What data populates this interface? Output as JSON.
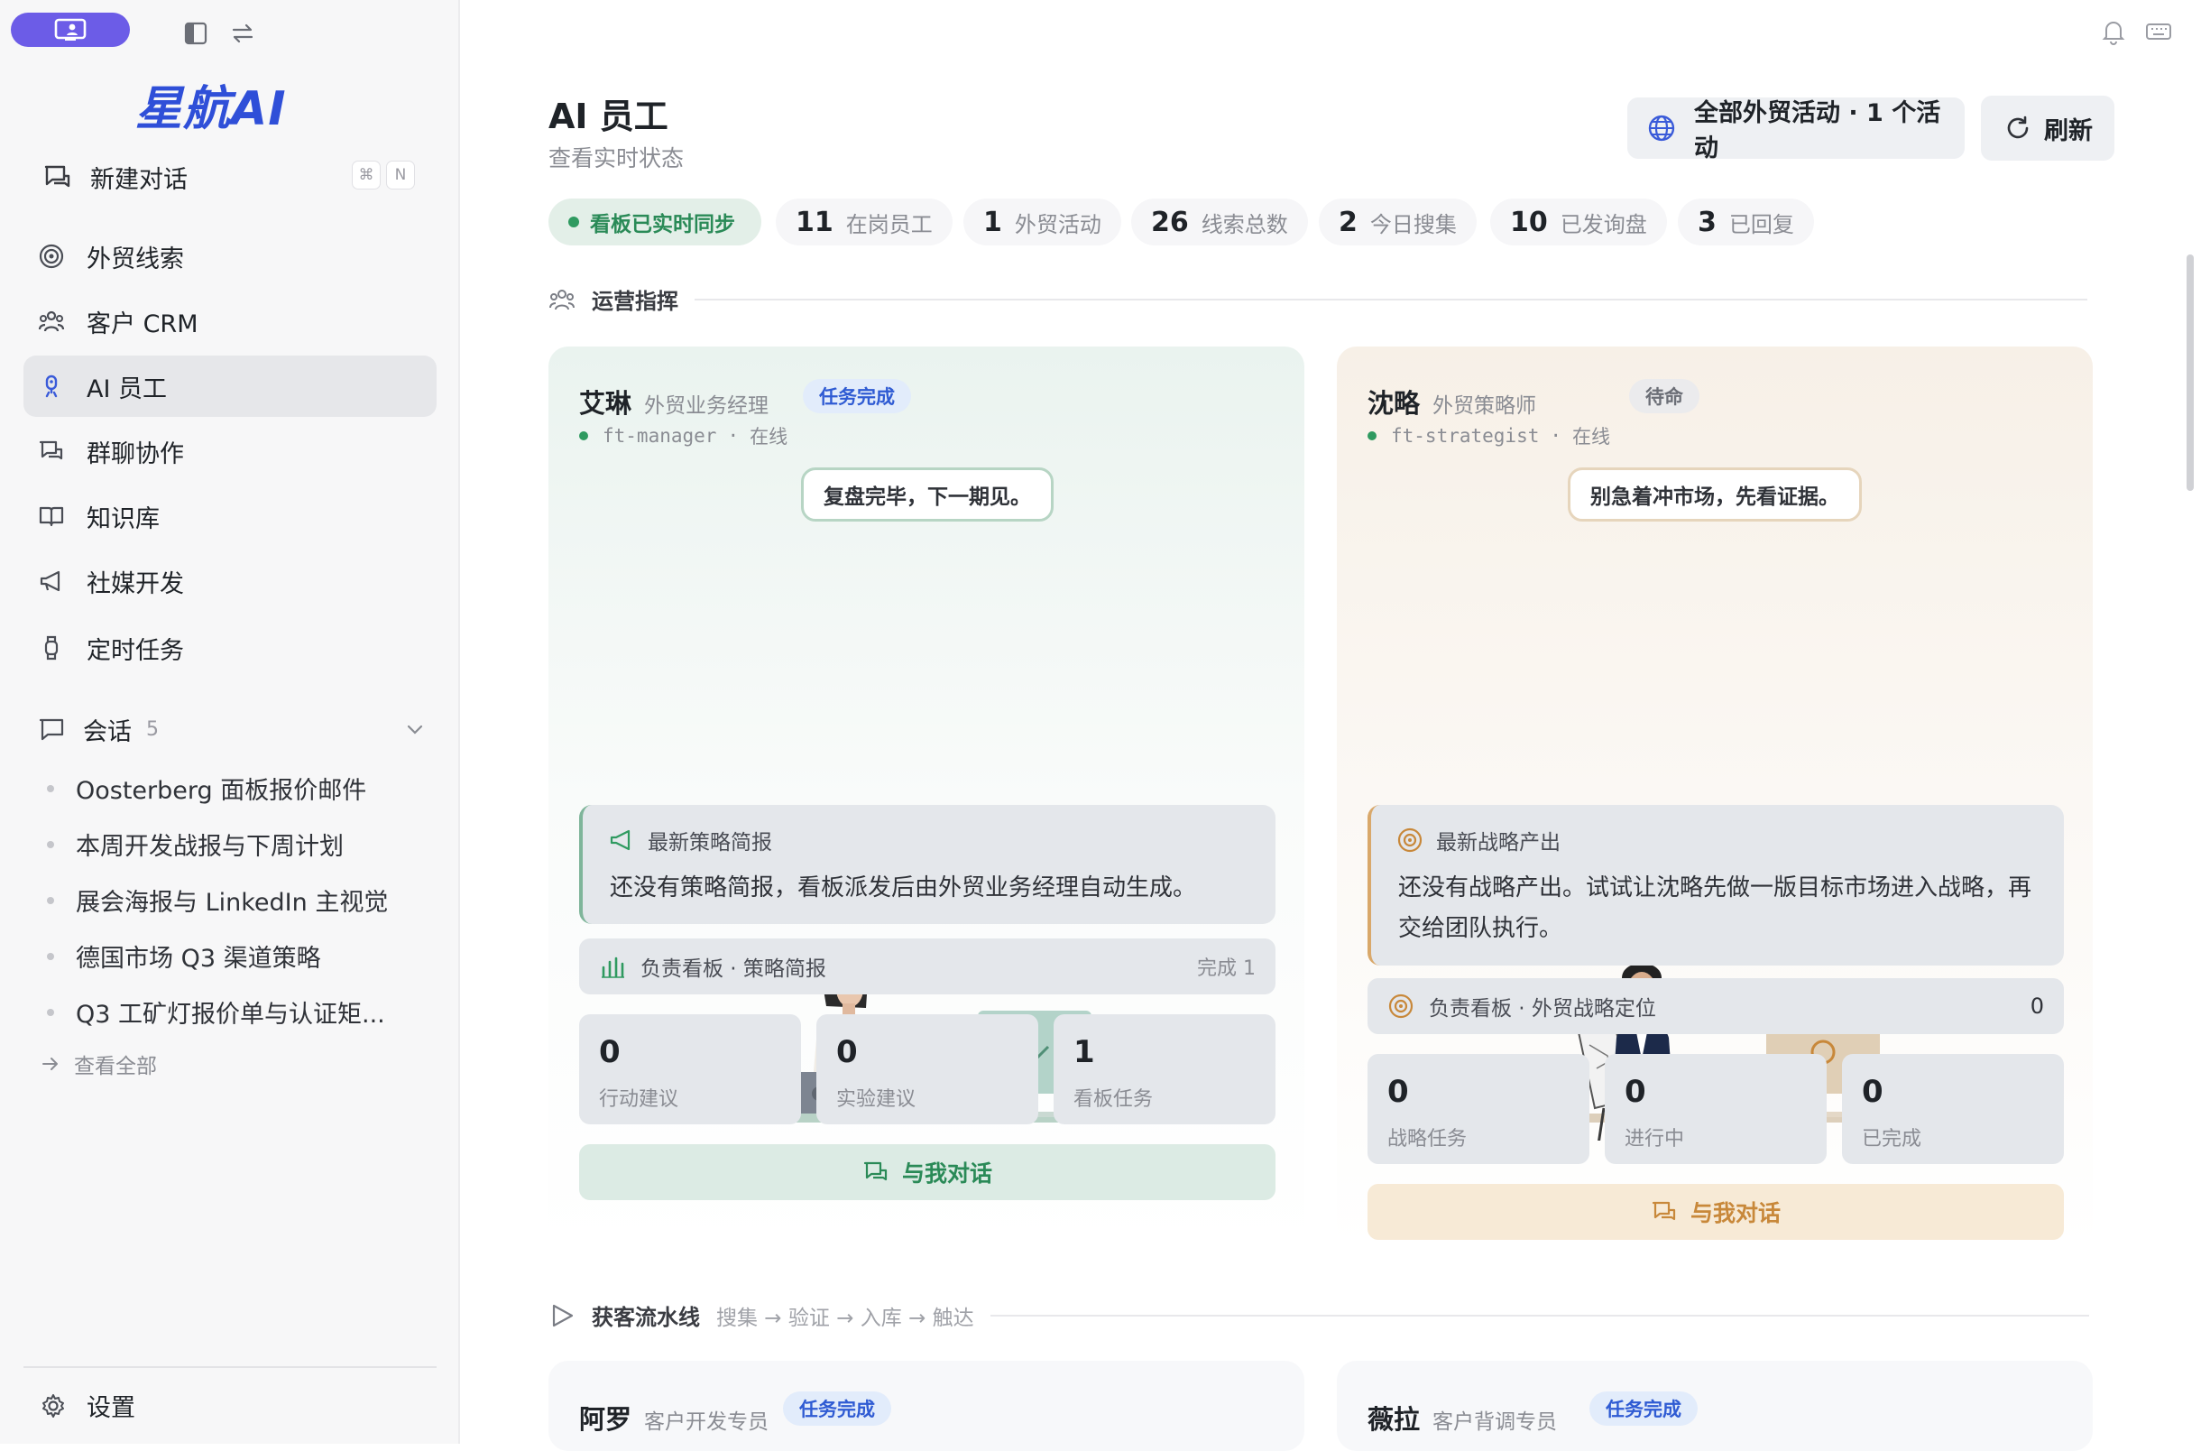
{
  "app": {
    "brand": "星航AI",
    "accent": "#6c5ce7",
    "brand_color": "#2f4fd8"
  },
  "sidebar": {
    "new_chat": {
      "label": "新建对话",
      "shortcut_cmd": "⌘",
      "shortcut_key": "N"
    },
    "items": [
      {
        "label": "外贸线索",
        "icon": "target-icon"
      },
      {
        "label": "客户 CRM",
        "icon": "users-icon"
      },
      {
        "label": "AI 员工",
        "icon": "robot-icon",
        "active": true
      },
      {
        "label": "群聊协作",
        "icon": "chat-bubbles-icon"
      },
      {
        "label": "知识库",
        "icon": "book-icon"
      },
      {
        "label": "社媒开发",
        "icon": "megaphone-icon"
      },
      {
        "label": "定时任务",
        "icon": "watch-icon"
      }
    ],
    "sessions": {
      "label": "会话",
      "count": "5",
      "items": [
        "Oosterberg 面板报价邮件",
        "本周开发战报与下周计划",
        "展会海报与 LinkedIn 主视觉",
        "德国市场 Q3 渠道策略",
        "Q3 工矿灯报价单与认证矩..."
      ],
      "view_all": "查看全部"
    },
    "settings": "设置"
  },
  "header": {
    "title": "AI 员工",
    "subtitle": "查看实时状态",
    "activity_button": "全部外贸活动 · 1 个活动",
    "refresh_button": "刷新"
  },
  "stats": {
    "sync": "看板已实时同步",
    "items": [
      {
        "n": "11",
        "t": "在岗员工"
      },
      {
        "n": "1",
        "t": "外贸活动"
      },
      {
        "n": "26",
        "t": "线索总数"
      },
      {
        "n": "2",
        "t": "今日搜集"
      },
      {
        "n": "10",
        "t": "已发询盘"
      },
      {
        "n": "3",
        "t": "已回复"
      }
    ]
  },
  "sections": {
    "ops": "运营指挥",
    "pipeline": "获客流水线",
    "pipeline_steps": "搜集 → 验证 → 入库 → 触达"
  },
  "agents": [
    {
      "name": "艾琳",
      "role": "外贸业务经理",
      "badge": "任务完成",
      "id": "ft-manager",
      "status": "在线",
      "bubble": "复盘完毕，下一期见。",
      "panel_title": "最新策略简报",
      "panel_body": "还没有策略简报，看板派发后由外贸业务经理自动生成。",
      "board": "负责看板 · 策略简报",
      "board_right": "完成 1",
      "metrics": [
        {
          "v": "0",
          "l": "行动建议"
        },
        {
          "v": "0",
          "l": "实验建议"
        },
        {
          "v": "1",
          "l": "看板任务"
        }
      ],
      "chat": "与我对话",
      "theme_color": "#2f9a60"
    },
    {
      "name": "沈略",
      "role": "外贸策略师",
      "badge": "待命",
      "id": "ft-strategist",
      "status": "在线",
      "bubble": "别急着冲市场，先看证据。",
      "panel_title": "最新战略产出",
      "panel_body": "还没有战略产出。试试让沈略先做一版目标市场进入战略，再交给团队执行。",
      "board": "负责看板 · 外贸战略定位",
      "board_right": "0",
      "metrics": [
        {
          "v": "0",
          "l": "战略任务"
        },
        {
          "v": "0",
          "l": "进行中"
        },
        {
          "v": "0",
          "l": "已完成"
        }
      ],
      "chat": "与我对话",
      "theme_color": "#c8883a"
    },
    {
      "name": "阿罗",
      "role": "客户开发专员",
      "badge": "任务完成"
    },
    {
      "name": "薇拉",
      "role": "客户背调专员",
      "badge": "任务完成"
    }
  ]
}
